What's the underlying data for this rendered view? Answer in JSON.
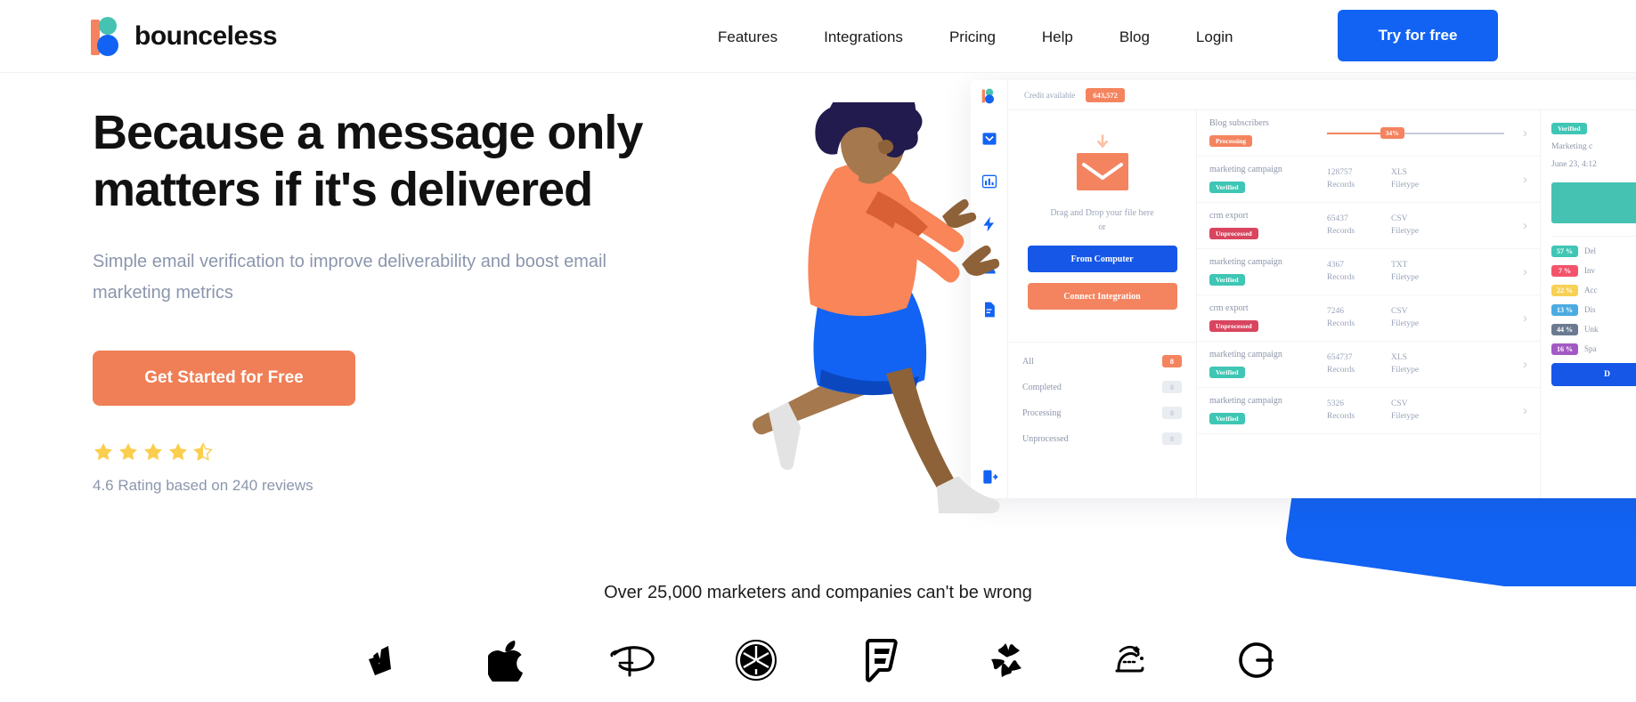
{
  "header": {
    "logo_text": "bounceless",
    "nav": [
      {
        "label": "Features"
      },
      {
        "label": "Integrations"
      },
      {
        "label": "Pricing"
      },
      {
        "label": "Help"
      },
      {
        "label": "Blog"
      },
      {
        "label": "Login"
      }
    ],
    "cta_label": "Try for free"
  },
  "hero": {
    "headline_line1": "Because a message only",
    "headline_line2": "matters if it's delivered",
    "subhead": "Simple email verification to improve deliverability and boost email marketing metrics",
    "cta_label": "Get Started for Free",
    "rating_value": 4.6,
    "rating_stars_full": 4,
    "rating_stars_half": 1,
    "rating_text": "4.6 Rating based on 240 reviews",
    "star_color": "#FBCE4E"
  },
  "dashboard": {
    "credit_label": "Credit available",
    "credit_value": "643,572",
    "upload": {
      "drop_line1": "Drag and Drop your file here",
      "drop_line2": "or",
      "btn_computer": "From Computer",
      "btn_integration": "Connect Integration"
    },
    "filters": [
      {
        "label": "All",
        "count": "8",
        "active": true
      },
      {
        "label": "Completed",
        "count": "8",
        "active": false
      },
      {
        "label": "Processing",
        "count": "8",
        "active": false
      },
      {
        "label": "Unprocessed",
        "count": "8",
        "active": false
      }
    ],
    "table_units": {
      "records": "Records",
      "filetype": "Filetype"
    },
    "rows": [
      {
        "title": "Blog subscribers",
        "status": "Processing",
        "status_kind": "processing",
        "progress": "34%",
        "records": "",
        "filetype": ""
      },
      {
        "title": "marketing campaign",
        "status": "Verified",
        "status_kind": "verified",
        "progress": "",
        "records": "128757",
        "filetype": "XLS"
      },
      {
        "title": "crm export",
        "status": "Unprocessed",
        "status_kind": "unprocessed",
        "progress": "",
        "records": "65437",
        "filetype": "CSV"
      },
      {
        "title": "marketing campaign",
        "status": "Verified",
        "status_kind": "verified",
        "progress": "",
        "records": "4367",
        "filetype": "TXT"
      },
      {
        "title": "crm export",
        "status": "Unprocessed",
        "status_kind": "unprocessed",
        "progress": "",
        "records": "7246",
        "filetype": "CSV"
      },
      {
        "title": "marketing campaign",
        "status": "Verified",
        "status_kind": "verified",
        "progress": "",
        "records": "654737",
        "filetype": "XLS"
      },
      {
        "title": "marketing campaign",
        "status": "Verified",
        "status_kind": "verified",
        "progress": "",
        "records": "5326",
        "filetype": "CSV"
      }
    ],
    "detail": {
      "badge": "Verified",
      "title": "Marketing c",
      "date": "June 23, 4:12",
      "stats": [
        {
          "pct": "57 %",
          "label": "Del",
          "color": "#3FC6B4"
        },
        {
          "pct": "7 %",
          "label": "Inv",
          "color": "#F3546B"
        },
        {
          "pct": "22 %",
          "label": "Acc",
          "color": "#F7D154"
        },
        {
          "pct": "13 %",
          "label": "Dis",
          "color": "#4BABE0"
        },
        {
          "pct": "44 %",
          "label": "Unk",
          "color": "#6B7A91"
        },
        {
          "pct": "16 %",
          "label": "Spa",
          "color": "#A359C4"
        }
      ],
      "download_label": "D"
    }
  },
  "social_proof": {
    "text": "Over 25,000 marketers and companies can't be wrong",
    "brands": [
      {
        "name": "deliveroo-logo"
      },
      {
        "name": "apple-logo"
      },
      {
        "name": "disney-logo"
      },
      {
        "name": "yamaha-logo"
      },
      {
        "name": "foursquare-logo"
      },
      {
        "name": "yelp-logo"
      },
      {
        "name": "calligraphy-logo"
      },
      {
        "name": "grammarly-logo"
      }
    ]
  },
  "colors": {
    "brand_blue": "#1263F3",
    "brand_orange": "#F07E56",
    "teal": "#45C2B1",
    "muted_text": "#8B96AC"
  }
}
